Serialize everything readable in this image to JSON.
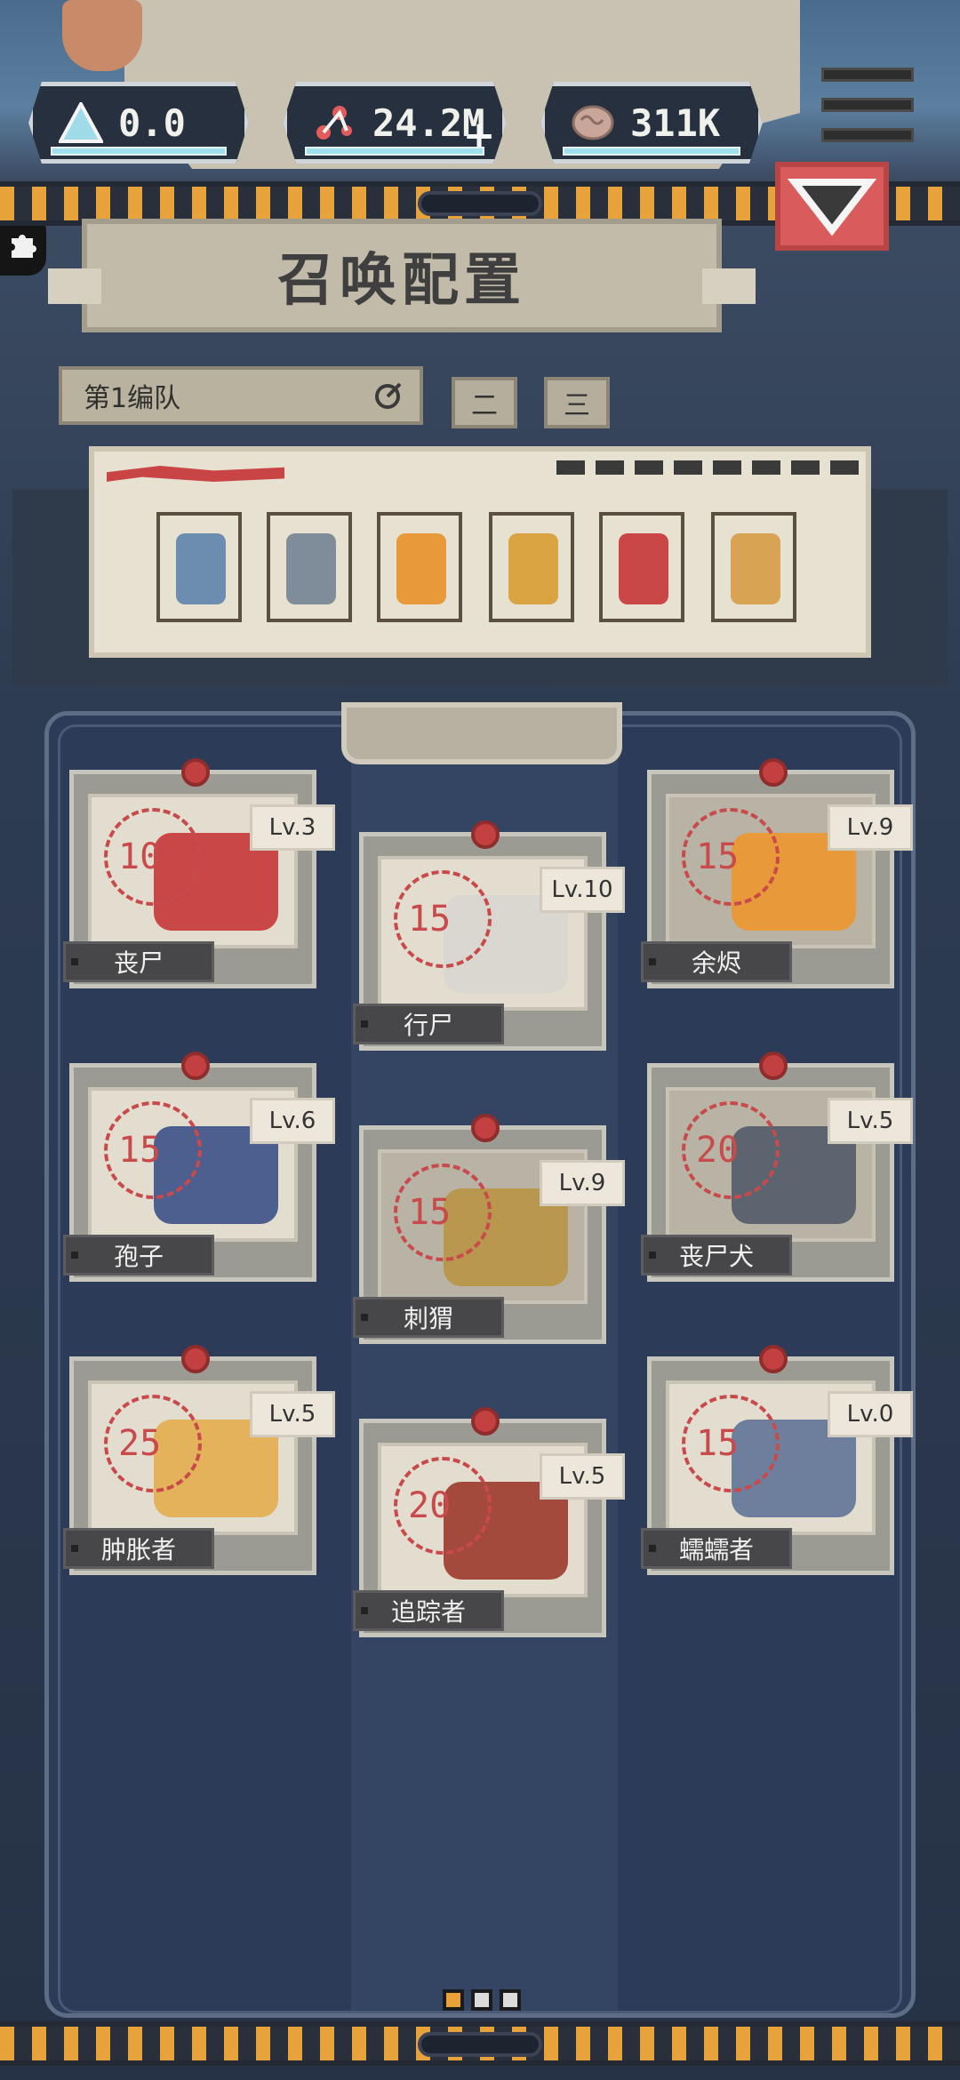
{
  "resources": [
    {
      "name": "gem",
      "icon": "crystal-icon",
      "value": "0.0"
    },
    {
      "name": "dna",
      "icon": "molecule-icon",
      "value": "24.2M"
    },
    {
      "name": "brain",
      "icon": "brain-icon",
      "value": "311K"
    }
  ],
  "page_title": "召唤配置",
  "squad": {
    "selected": "第1编队",
    "tabs": [
      "二",
      "三"
    ]
  },
  "team_slots": [
    {
      "unit": "blue-zombie",
      "color": "#6c8db0"
    },
    {
      "unit": "zombie-dog",
      "color": "#7f8c9a"
    },
    {
      "unit": "ember",
      "color": "#e89a3a"
    },
    {
      "unit": "worker",
      "color": "#d9a441"
    },
    {
      "unit": "axe-zombie",
      "color": "#c94747"
    },
    {
      "unit": "hedgehog",
      "color": "#d8a454"
    }
  ],
  "cards": [
    {
      "name": "丧尸",
      "cost": "10",
      "level": "Lv.3",
      "color": "#c94747",
      "dim": false
    },
    {
      "name": "行尸",
      "cost": "15",
      "level": "Lv.10",
      "color": "#d9d7d0",
      "dim": false
    },
    {
      "name": "余烬",
      "cost": "15",
      "level": "Lv.9",
      "color": "#e89a3a",
      "dim": true
    },
    {
      "name": "孢子",
      "cost": "15",
      "level": "Lv.6",
      "color": "#4c5f8f",
      "dim": false
    },
    {
      "name": "刺猬",
      "cost": "15",
      "level": "Lv.9",
      "color": "#b9974e",
      "dim": true
    },
    {
      "name": "丧尸犬",
      "cost": "20",
      "level": "Lv.5",
      "color": "#5c6470",
      "dim": true
    },
    {
      "name": "肿胀者",
      "cost": "25",
      "level": "Lv.5",
      "color": "#e3b25a",
      "dim": false
    },
    {
      "name": "追踪者",
      "cost": "20",
      "level": "Lv.5",
      "color": "#a44a3c",
      "dim": false
    },
    {
      "name": "蠕蠕者",
      "cost": "15",
      "level": "Lv.0",
      "color": "#6e7f9e",
      "dim": false
    }
  ],
  "pager": {
    "total": 3,
    "current": 1
  }
}
